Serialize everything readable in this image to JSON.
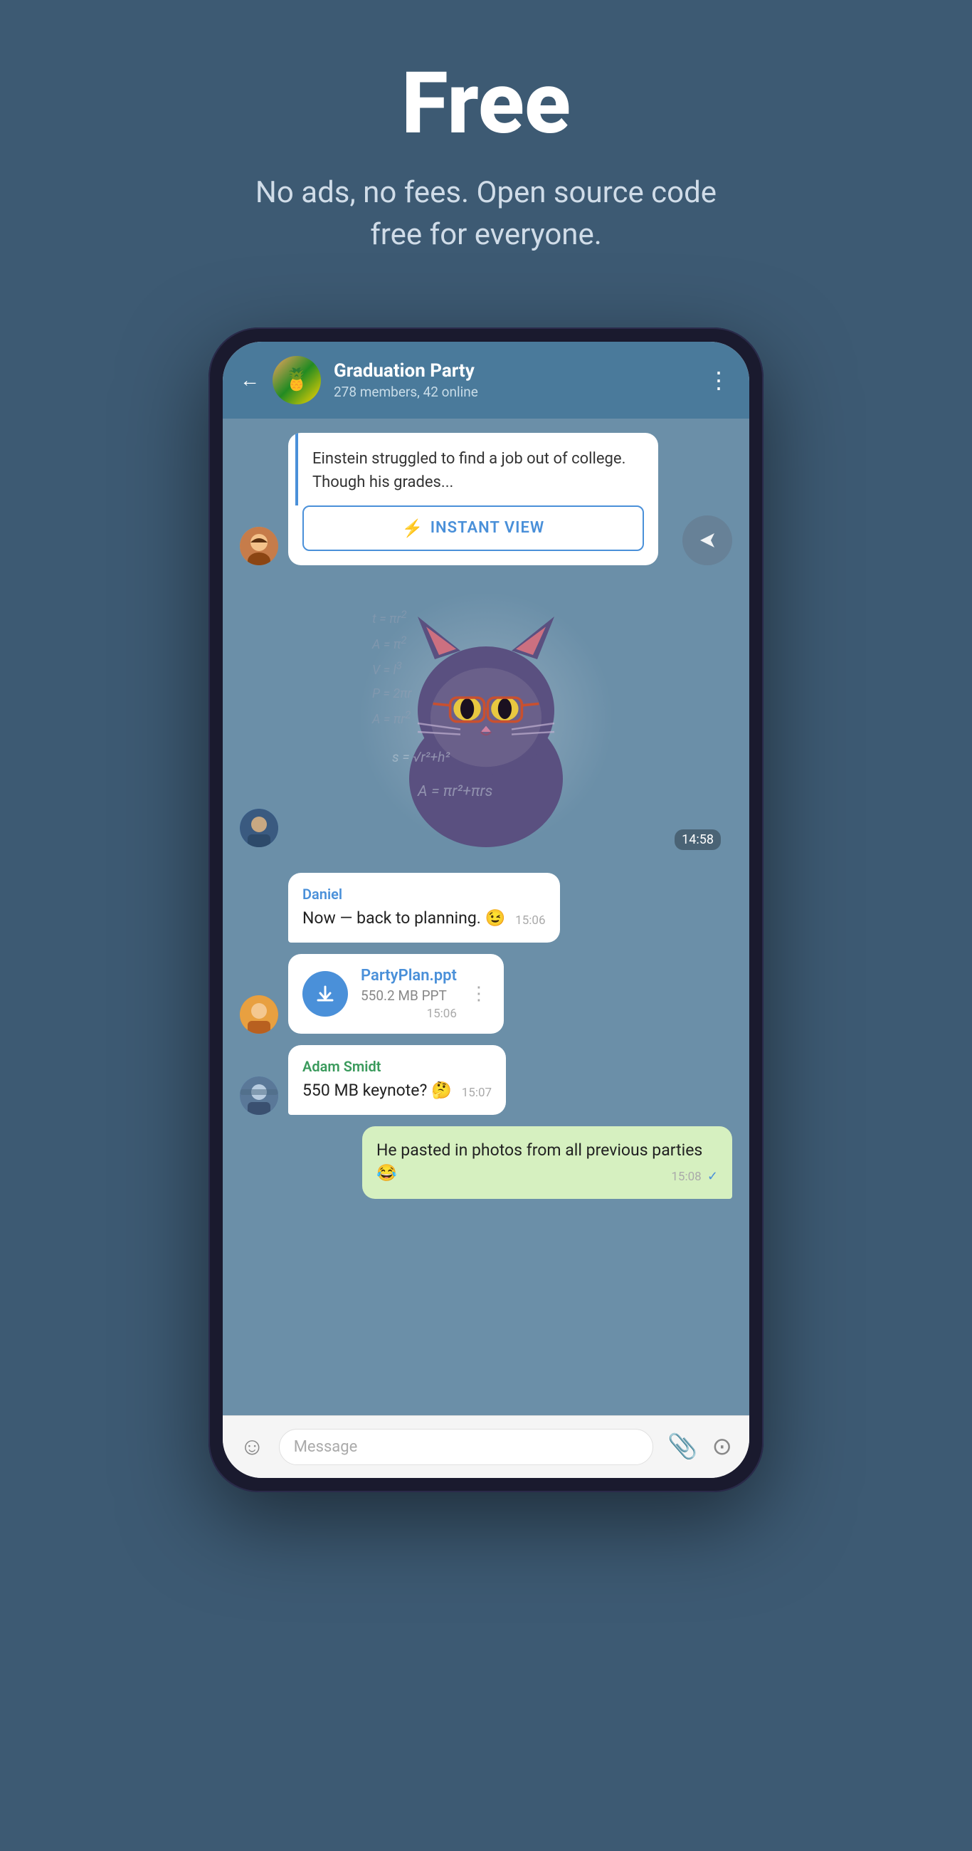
{
  "hero": {
    "title": "Free",
    "subtitle": "No ads, no fees. Open source code free for everyone."
  },
  "chat": {
    "back_label": "←",
    "group_name": "Graduation Party",
    "group_members": "278 members, 42 online",
    "more_icon": "⋮",
    "group_emoji": "🍍"
  },
  "messages": [
    {
      "id": "link-preview",
      "type": "link",
      "preview_text": "Einstein struggled to find a job out of college. Though his grades...",
      "instant_view_label": "INSTANT VIEW",
      "bolt": "⚡",
      "share_icon": "↗"
    },
    {
      "id": "sticker",
      "type": "sticker",
      "time": "14:58"
    },
    {
      "id": "daniel-msg",
      "type": "text",
      "sender": "Daniel",
      "text": "Now — back to planning. 😉",
      "time": "15:06"
    },
    {
      "id": "file-msg",
      "type": "file",
      "file_name": "PartyPlan.ppt",
      "file_size": "550.2 MB PPT",
      "time": "15:06",
      "more_icon": "⋮"
    },
    {
      "id": "adam-msg",
      "type": "text",
      "sender": "Adam Smidt",
      "text": "550 MB keynote? 🤔",
      "time": "15:07"
    },
    {
      "id": "own-msg",
      "type": "own",
      "text": "He pasted in photos from all previous parties 😂",
      "time": "15:08"
    }
  ],
  "input_bar": {
    "emoji_icon": "☺",
    "placeholder": "Message",
    "attach_icon": "📎",
    "camera_icon": "⊙"
  },
  "colors": {
    "header_bg": "#4a7a9b",
    "chat_bg": "#6b8fa8",
    "bubble_white": "#ffffff",
    "bubble_own": "#d6f0c0",
    "accent_blue": "#4a90d9",
    "text_dark": "#222222",
    "page_bg": "#3d5a73"
  }
}
